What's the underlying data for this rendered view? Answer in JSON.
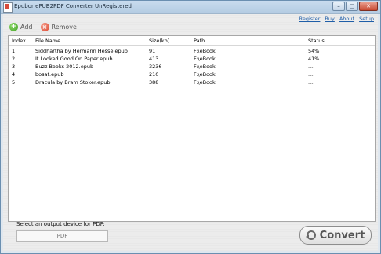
{
  "window": {
    "title": "Epubor ePUB2PDF Converter UnRegistered",
    "minimize": "–",
    "maximize": "□",
    "close": "✕"
  },
  "links": {
    "register": "Register",
    "buy": "Buy",
    "about": "About",
    "setup": "Setup"
  },
  "toolbar": {
    "add": "Add",
    "remove": "Remove"
  },
  "table": {
    "headers": [
      "Index",
      "File Name",
      "Size(kb)",
      "Path",
      "Status"
    ],
    "rows": [
      [
        "1",
        "Siddhartha by Hermann Hesse.epub",
        "91",
        "F:\\eBook",
        "54%"
      ],
      [
        "2",
        "It Looked Good On Paper.epub",
        "413",
        "F:\\eBook",
        "41%"
      ],
      [
        "3",
        "Buzz Books 2012.epub",
        "3236",
        "F:\\eBook",
        "...."
      ],
      [
        "4",
        "bosat.epub",
        "210",
        "F:\\eBook",
        "...."
      ],
      [
        "5",
        "Dracula by Bram Stoker.epub",
        "388",
        "F:\\eBook",
        "...."
      ]
    ]
  },
  "output": {
    "label": "Select an output device for PDF:",
    "device": "PDF"
  },
  "convert": {
    "label": "Convert"
  }
}
